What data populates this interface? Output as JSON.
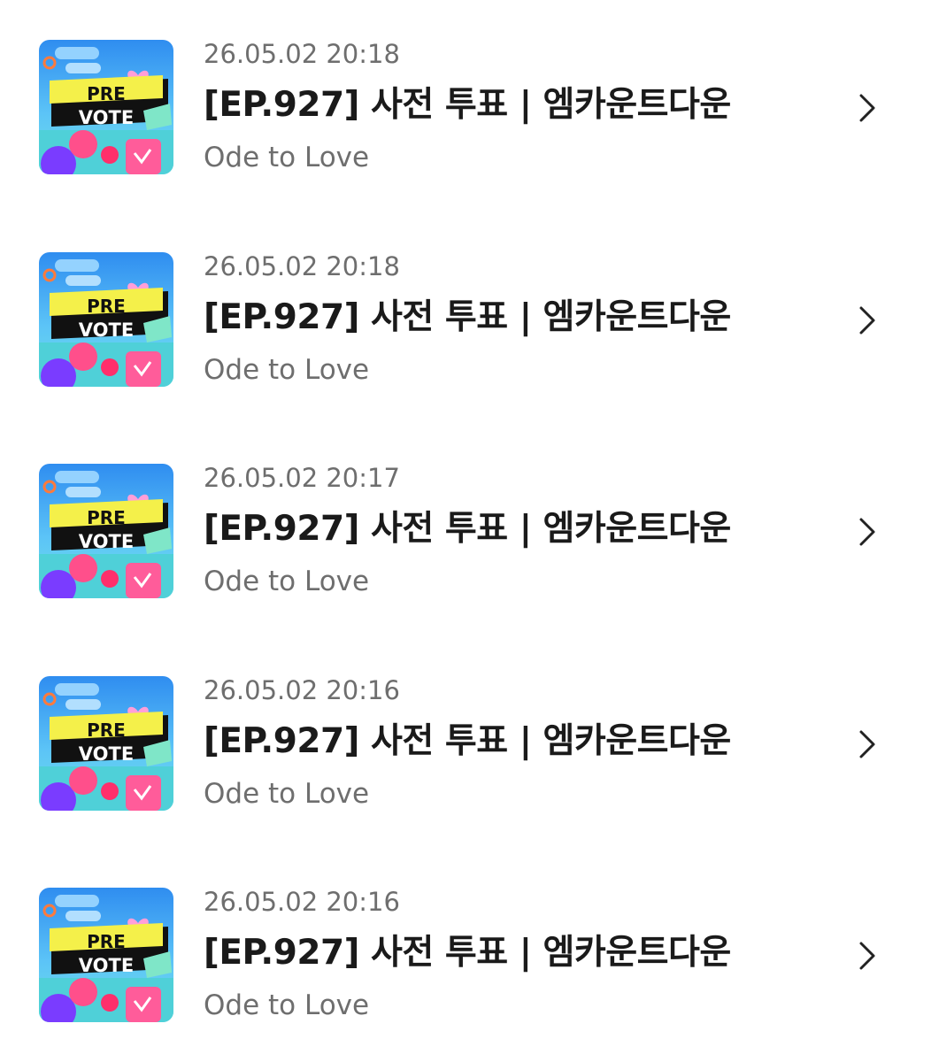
{
  "items": [
    {
      "date": "26.05.02 20:18",
      "title": "[EP.927] 사전 투표 | 엠카운트다운",
      "subtitle": "Ode to Love",
      "thumb": {
        "line1": "PRE",
        "line2": "VOTE"
      },
      "icon": "chevron-right-icon"
    },
    {
      "date": "26.05.02 20:18",
      "title": "[EP.927] 사전 투표 | 엠카운트다운",
      "subtitle": "Ode to Love",
      "thumb": {
        "line1": "PRE",
        "line2": "VOTE"
      },
      "icon": "chevron-right-icon"
    },
    {
      "date": "26.05.02 20:17",
      "title": "[EP.927] 사전 투표 | 엠카운트다운",
      "subtitle": "Ode to Love",
      "thumb": {
        "line1": "PRE",
        "line2": "VOTE"
      },
      "icon": "chevron-right-icon"
    },
    {
      "date": "26.05.02 20:16",
      "title": "[EP.927] 사전 투표 | 엠카운트다운",
      "subtitle": "Ode to Love",
      "thumb": {
        "line1": "PRE",
        "line2": "VOTE"
      },
      "icon": "chevron-right-icon"
    },
    {
      "date": "26.05.02 20:16",
      "title": "[EP.927] 사전 투표 | 엠카운트다운",
      "subtitle": "Ode to Love",
      "thumb": {
        "line1": "PRE",
        "line2": "VOTE"
      },
      "icon": "chevron-right-icon"
    }
  ],
  "colors": {
    "title": "#1a1a1a",
    "meta": "#6e6e6e",
    "chevron": "#222222",
    "thumb_sky": "#3fa9f5",
    "thumb_banner": "#f4f04a",
    "thumb_pink": "#ff4f8b",
    "thumb_purple": "#7a3cff",
    "thumb_teal": "#3fd6d0"
  }
}
